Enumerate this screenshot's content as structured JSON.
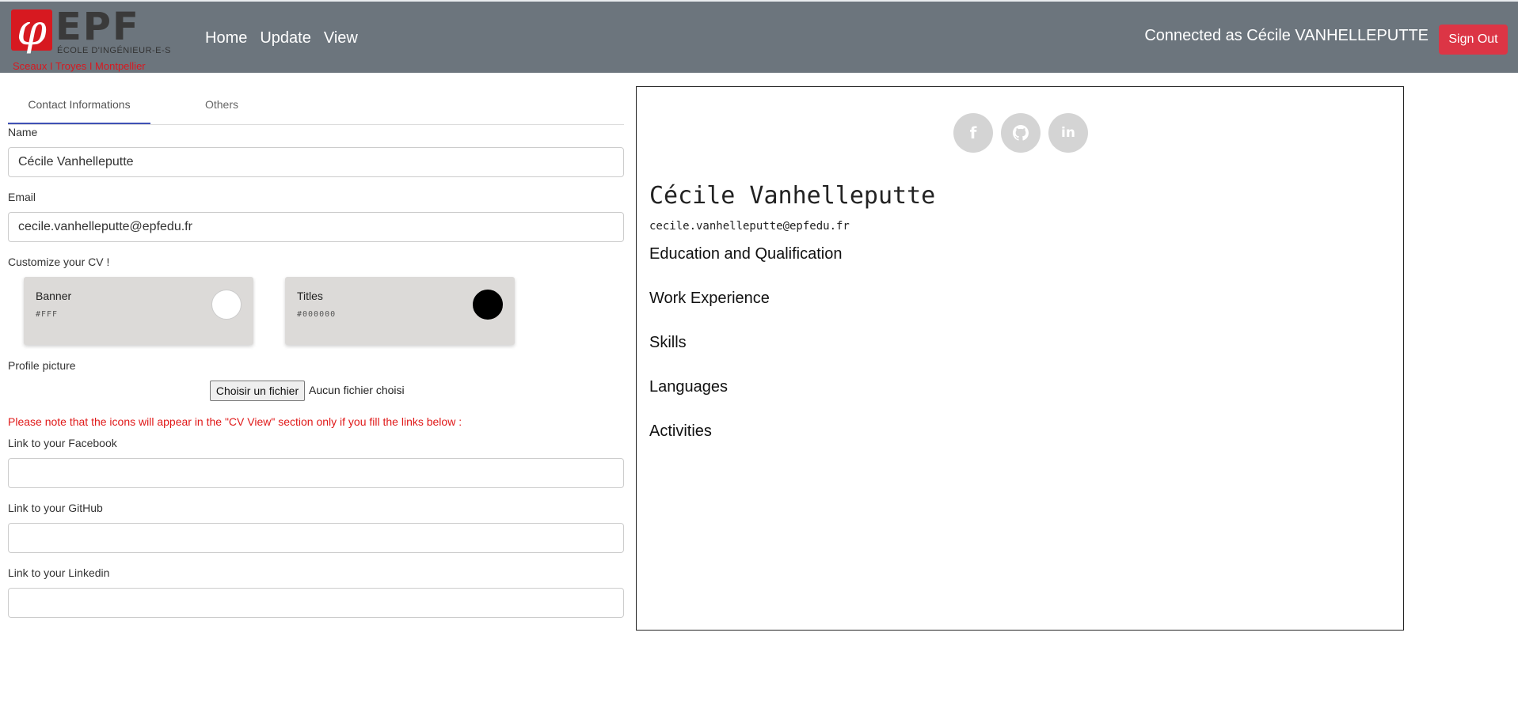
{
  "header": {
    "logo": {
      "word": "EPF",
      "subtitle": "ÉCOLE D'INGÉNIEUR-E-S",
      "cities": "Sceaux  I  Troyes  I  Montpellier"
    },
    "nav": [
      "Home",
      "Update",
      "View"
    ],
    "connected_text": "Connected as Cécile VANHELLEPUTTE",
    "signout_label": "Sign Out",
    "bg_color": "#6c757d",
    "signout_color": "#dc3545"
  },
  "tabs": [
    {
      "label": "Contact Informations",
      "active": true
    },
    {
      "label": "Others",
      "active": false
    }
  ],
  "form": {
    "name_label": "Name",
    "name_value": "Cécile Vanhelleputte",
    "email_label": "Email",
    "email_value": "cecile.vanhelleputte@epfedu.fr",
    "customize_label": "Customize your CV !",
    "banner": {
      "title": "Banner",
      "value": "#FFF",
      "color": "#ffffff"
    },
    "titles": {
      "title": "Titles",
      "value": "#000000",
      "color": "#000000"
    },
    "picture_label": "Profile picture",
    "file_button": "Choisir un fichier",
    "file_status": "Aucun fichier choisi",
    "note": "Please note that the icons will appear in the \"CV View\" section only if you fill the links below :",
    "facebook_label": "Link to your Facebook",
    "facebook_value": "",
    "github_label": "Link to your GitHub",
    "github_value": "",
    "linkedin_label": "Link to your Linkedin",
    "linkedin_value": ""
  },
  "preview": {
    "social_icons": [
      "facebook-icon",
      "github-icon",
      "linkedin-icon"
    ],
    "name": "Cécile Vanhelleputte",
    "email": "cecile.vanhelleputte@epfedu.fr",
    "sections": [
      "Education and Qualification",
      "Work Experience",
      "Skills",
      "Languages",
      "Activities"
    ]
  }
}
